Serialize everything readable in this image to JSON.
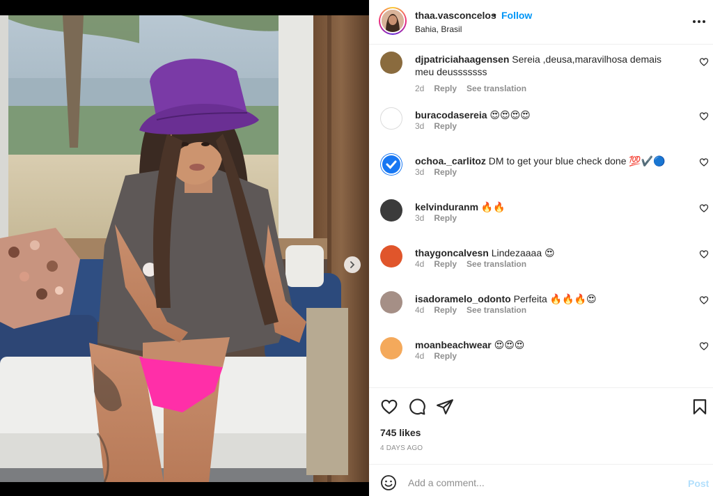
{
  "post": {
    "username": "thaa.vasconcelos",
    "bullet": "•",
    "follow_label": "Follow",
    "location": "Bahia, Brasil",
    "more_icon": "more-horizontal-icon"
  },
  "media": {
    "carousel_total": 4,
    "carousel_active": 1,
    "next_icon": "chevron-right-icon"
  },
  "comments": [
    {
      "user": "djpatriciahaagensen",
      "text": "Sereia ,deusa,maravilhosa demais meu deusssssss",
      "age": "2d",
      "reply": "Reply",
      "translate": "See translation",
      "avatar_color": "#8a6b3e"
    },
    {
      "user": "buracodasereia",
      "text": "😍😍😍😍",
      "age": "3d",
      "reply": "Reply",
      "translate": "",
      "avatar_color": "#ffffff"
    },
    {
      "user": "ochoa._carlitoz",
      "text": "DM to get your blue check done 💯✔️🔵",
      "age": "3d",
      "reply": "Reply",
      "translate": "",
      "avatar_color": "#1877f2"
    },
    {
      "user": "kelvinduranm",
      "text": "🔥🔥",
      "age": "3d",
      "reply": "Reply",
      "translate": "",
      "avatar_color": "#3b3b3b"
    },
    {
      "user": "thaygoncalvesn",
      "text": "Lindezaaaa 😍",
      "age": "4d",
      "reply": "Reply",
      "translate": "See translation",
      "avatar_color": "#e0552b"
    },
    {
      "user": "isadoramelo_odonto",
      "text": "Perfeita 🔥🔥🔥😍",
      "age": "4d",
      "reply": "Reply",
      "translate": "See translation",
      "avatar_color": "#a58f86"
    },
    {
      "user": "moanbeachwear",
      "text": "😍😍😍",
      "age": "4d",
      "reply": "Reply",
      "translate": "",
      "avatar_color": "#f4a95b"
    }
  ],
  "actions": {
    "like_icon": "heart-icon",
    "comment_icon": "comment-icon",
    "share_icon": "share-icon",
    "save_icon": "bookmark-icon"
  },
  "likes_text": "745 likes",
  "date_text": "4 DAYS AGO",
  "composer": {
    "emoji_icon": "emoji-icon",
    "placeholder": "Add a comment...",
    "post_label": "Post"
  },
  "colors": {
    "accent": "#0095f6",
    "muted": "#8e8e8e",
    "post_disabled": "#b2dffc"
  }
}
